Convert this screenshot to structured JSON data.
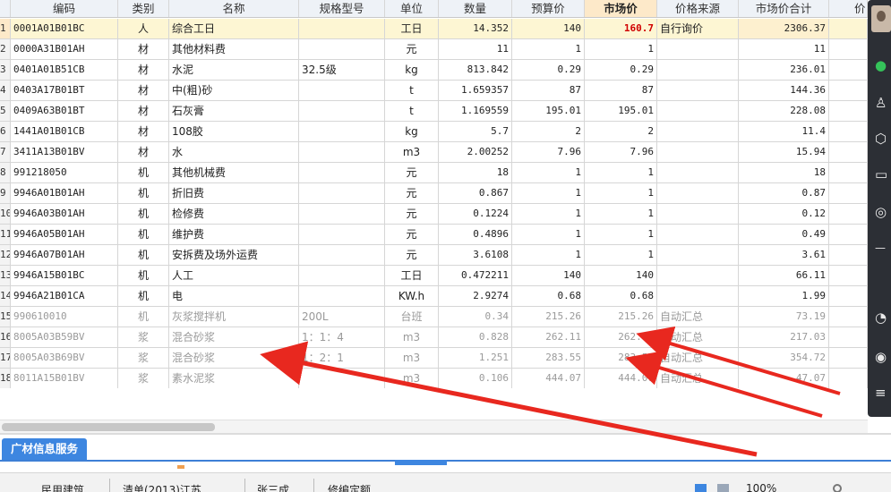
{
  "columns": {
    "idx": "",
    "code": "编码",
    "type": "类别",
    "name": "名称",
    "spec": "规格型号",
    "unit": "单位",
    "qty": "数量",
    "budget": "预算价",
    "market": "市场价",
    "source": "价格来源",
    "total": "市场价合计",
    "extra": "价"
  },
  "rows": [
    {
      "idx": "1",
      "code": "0001A01B01BC",
      "type": "人",
      "name": "综合工日",
      "spec": "",
      "unit": "工日",
      "qty": "14.352",
      "budget": "140",
      "market": "160.7",
      "source": "自行询价",
      "total": "2306.37",
      "gray": false,
      "selected": true
    },
    {
      "idx": "2",
      "code": "0000A31B01AH",
      "type": "材",
      "name": "其他材料费",
      "spec": "",
      "unit": "元",
      "qty": "11",
      "budget": "1",
      "market": "1",
      "source": "",
      "total": "11",
      "gray": false
    },
    {
      "idx": "3",
      "code": "0401A01B51CB",
      "type": "材",
      "name": "水泥",
      "spec": "32.5级",
      "unit": "kg",
      "qty": "813.842",
      "budget": "0.29",
      "market": "0.29",
      "source": "",
      "total": "236.01",
      "gray": false
    },
    {
      "idx": "4",
      "code": "0403A17B01BT",
      "type": "材",
      "name": "中(粗)砂",
      "spec": "",
      "unit": "t",
      "qty": "1.659357",
      "budget": "87",
      "market": "87",
      "source": "",
      "total": "144.36",
      "gray": false
    },
    {
      "idx": "5",
      "code": "0409A63B01BT",
      "type": "材",
      "name": "石灰膏",
      "spec": "",
      "unit": "t",
      "qty": "1.169559",
      "budget": "195.01",
      "market": "195.01",
      "source": "",
      "total": "228.08",
      "gray": false
    },
    {
      "idx": "6",
      "code": "1441A01B01CB",
      "type": "材",
      "name": "108胶",
      "spec": "",
      "unit": "kg",
      "qty": "5.7",
      "budget": "2",
      "market": "2",
      "source": "",
      "total": "11.4",
      "gray": false
    },
    {
      "idx": "7",
      "code": "3411A13B01BV",
      "type": "材",
      "name": "水",
      "spec": "",
      "unit": "m3",
      "qty": "2.00252",
      "budget": "7.96",
      "market": "7.96",
      "source": "",
      "total": "15.94",
      "gray": false
    },
    {
      "idx": "8",
      "code": "991218050",
      "type": "机",
      "name": "其他机械费",
      "spec": "",
      "unit": "元",
      "qty": "18",
      "budget": "1",
      "market": "1",
      "source": "",
      "total": "18",
      "gray": false
    },
    {
      "idx": "9",
      "code": "9946A01B01AH",
      "type": "机",
      "name": "折旧费",
      "spec": "",
      "unit": "元",
      "qty": "0.867",
      "budget": "1",
      "market": "1",
      "source": "",
      "total": "0.87",
      "gray": false
    },
    {
      "idx": "10",
      "code": "9946A03B01AH",
      "type": "机",
      "name": "检修费",
      "spec": "",
      "unit": "元",
      "qty": "0.1224",
      "budget": "1",
      "market": "1",
      "source": "",
      "total": "0.12",
      "gray": false
    },
    {
      "idx": "11",
      "code": "9946A05B01AH",
      "type": "机",
      "name": "维护费",
      "spec": "",
      "unit": "元",
      "qty": "0.4896",
      "budget": "1",
      "market": "1",
      "source": "",
      "total": "0.49",
      "gray": false
    },
    {
      "idx": "12",
      "code": "9946A07B01AH",
      "type": "机",
      "name": "安拆费及场外运费",
      "spec": "",
      "unit": "元",
      "qty": "3.6108",
      "budget": "1",
      "market": "1",
      "source": "",
      "total": "3.61",
      "gray": false
    },
    {
      "idx": "13",
      "code": "9946A15B01BC",
      "type": "机",
      "name": "人工",
      "spec": "",
      "unit": "工日",
      "qty": "0.472211",
      "budget": "140",
      "market": "140",
      "source": "",
      "total": "66.11",
      "gray": false
    },
    {
      "idx": "14",
      "code": "9946A21B01CA",
      "type": "机",
      "name": "电",
      "spec": "",
      "unit": "KW.h",
      "qty": "2.9274",
      "budget": "0.68",
      "market": "0.68",
      "source": "",
      "total": "1.99",
      "gray": false
    },
    {
      "idx": "15",
      "code": "990610010",
      "type": "机",
      "name": "灰浆搅拌机",
      "spec": "200L",
      "unit": "台班",
      "qty": "0.34",
      "budget": "215.26",
      "market": "215.26",
      "source": "自动汇总",
      "total": "73.19",
      "gray": true
    },
    {
      "idx": "16",
      "code": "8005A03B59BV",
      "type": "浆",
      "name": "混合砂浆",
      "spec": "1：1：4",
      "unit": "m3",
      "qty": "0.828",
      "budget": "262.11",
      "market": "262.11",
      "source": "自动汇总",
      "total": "217.03",
      "gray": true
    },
    {
      "idx": "17",
      "code": "8005A03B69BV",
      "type": "浆",
      "name": "混合砂浆",
      "spec": "1：2：1",
      "unit": "m3",
      "qty": "1.251",
      "budget": "283.55",
      "market": "283.55",
      "source": "自动汇总",
      "total": "354.72",
      "gray": true
    },
    {
      "idx": "18",
      "code": "8011A15B01BV",
      "type": "浆",
      "name": "素水泥浆",
      "spec": "",
      "unit": "m3",
      "qty": "0.106",
      "budget": "444.07",
      "market": "444.07",
      "source": "自动汇总",
      "total": "47.07",
      "gray": true
    }
  ],
  "bottom_tab": "广材信息服务",
  "status": {
    "item1": "民用建筑",
    "item2": "清单(2013)江苏",
    "item3": "张三成",
    "item4": "修编定额",
    "zoom": "100%"
  },
  "colors": {
    "accent": "#3d86e0",
    "highlight_row": "#fdf6d3",
    "market_red": "#d00000",
    "arrow_red": "#e8281f"
  },
  "icons": [
    "chat-icon",
    "user-icon",
    "cube-icon",
    "folder-icon",
    "globe-icon",
    "refresh-icon",
    "list-icon"
  ]
}
